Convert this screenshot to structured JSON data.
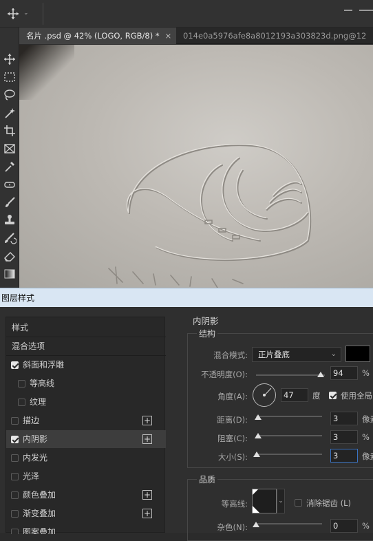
{
  "tabs": [
    {
      "label": "名片 .psd @ 42% (LOGO, RGB/8) *",
      "close": "×"
    },
    {
      "label": "014e0a5976afe8a8012193a303823d.png@12"
    }
  ],
  "tools": [
    "move-icon",
    "marquee-icon",
    "lasso-icon",
    "magic-wand-icon",
    "crop-icon",
    "frame-icon",
    "eyedropper-icon",
    "healing-brush-icon",
    "brush-icon",
    "clone-stamp-icon",
    "history-brush-icon",
    "eraser-icon",
    "gradient-icon"
  ],
  "dialog": {
    "title": "图层样式",
    "style_list": [
      {
        "label": "样式",
        "checkbox": null,
        "plus": false
      },
      {
        "label": "混合选项",
        "checkbox": null,
        "plus": false
      },
      {
        "label": "斜面和浮雕",
        "checkbox": true,
        "plus": false
      },
      {
        "label": "等高线",
        "checkbox": false,
        "plus": false,
        "indent": true
      },
      {
        "label": "纹理",
        "checkbox": false,
        "plus": false,
        "indent": true
      },
      {
        "label": "描边",
        "checkbox": false,
        "plus": true
      },
      {
        "label": "内阴影",
        "checkbox": true,
        "plus": true,
        "selected": true
      },
      {
        "label": "内发光",
        "checkbox": false,
        "plus": false
      },
      {
        "label": "光泽",
        "checkbox": false,
        "plus": false
      },
      {
        "label": "颜色叠加",
        "checkbox": false,
        "plus": true
      },
      {
        "label": "渐变叠加",
        "checkbox": false,
        "plus": true
      },
      {
        "label": "图案叠加",
        "checkbox": false,
        "plus": false
      }
    ],
    "panel_title": "内阴影",
    "structure": {
      "title": "结构",
      "blend_mode_label": "混合模式:",
      "blend_mode_value": "正片叠底",
      "shadow_color": "#000000",
      "opacity_label": "不透明度(O):",
      "opacity_value": "94",
      "opacity_unit": "%",
      "angle_label": "角度(A):",
      "angle_value": "47",
      "angle_unit": "度",
      "global_light_label": "使用全局",
      "global_light_checked": true,
      "distance_label": "距离(D):",
      "distance_value": "3",
      "distance_unit": "像素",
      "choke_label": "阻塞(C):",
      "choke_value": "3",
      "choke_unit": "%",
      "size_label": "大小(S):",
      "size_value": "3",
      "size_unit": "像素"
    },
    "quality": {
      "title": "品质",
      "contour_label": "等高线:",
      "antialias_label": "消除锯齿 (L)",
      "antialias_checked": false,
      "noise_label": "杂色(N):",
      "noise_value": "0",
      "noise_unit": "%"
    }
  }
}
